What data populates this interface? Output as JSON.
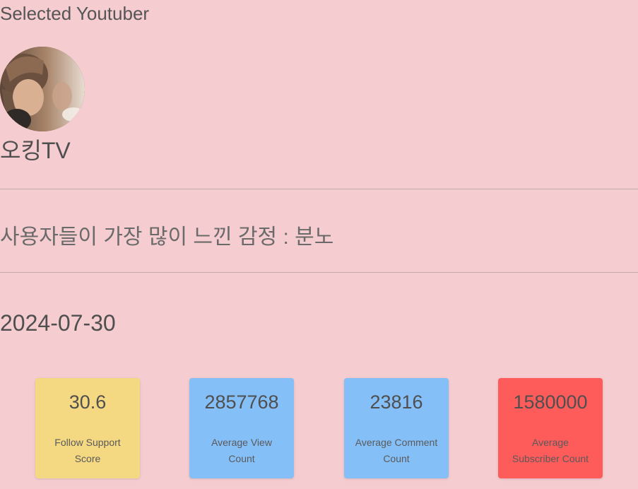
{
  "section_title": "Selected Youtuber",
  "channel": {
    "name": "오킹TV"
  },
  "emotion_summary": "사용자들이 가장 많이 느낀 감정 : 분노",
  "date": "2024-07-30",
  "stats": [
    {
      "value": "30.6",
      "label": "Follow Support Score",
      "color": "#f5d882"
    },
    {
      "value": "2857768",
      "label": "Average View Count",
      "color": "#85bff7"
    },
    {
      "value": "23816",
      "label": "Average Comment Count",
      "color": "#85bff7"
    },
    {
      "value": "1580000",
      "label": "Average Subscriber Count",
      "color": "#fe5b5b"
    }
  ]
}
